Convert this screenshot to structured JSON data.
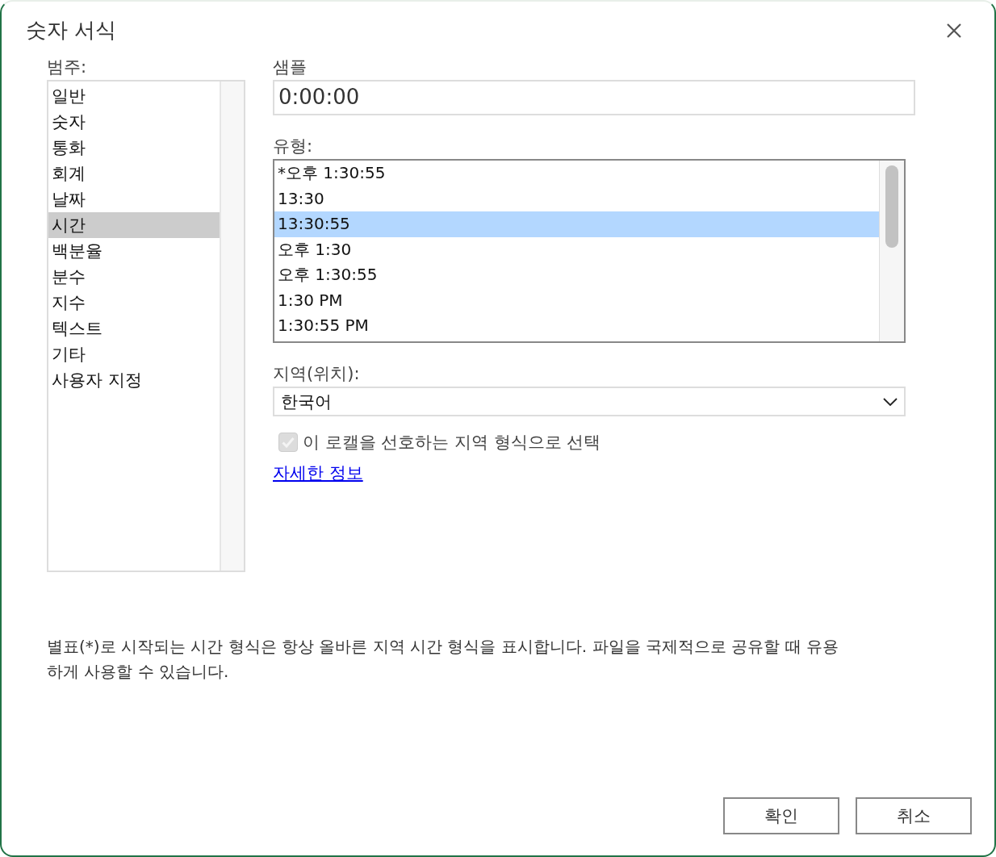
{
  "dialog": {
    "title": "숫자 서식"
  },
  "category": {
    "label": "범주:",
    "items": [
      {
        "label": "일반",
        "selected": false
      },
      {
        "label": "숫자",
        "selected": false
      },
      {
        "label": "통화",
        "selected": false
      },
      {
        "label": "회계",
        "selected": false
      },
      {
        "label": "날짜",
        "selected": false
      },
      {
        "label": "시간",
        "selected": true
      },
      {
        "label": "백분율",
        "selected": false
      },
      {
        "label": "분수",
        "selected": false
      },
      {
        "label": "지수",
        "selected": false
      },
      {
        "label": "텍스트",
        "selected": false
      },
      {
        "label": "기타",
        "selected": false
      },
      {
        "label": "사용자 지정",
        "selected": false
      }
    ]
  },
  "sample": {
    "label": "샘플",
    "value": "0:00:00"
  },
  "type": {
    "label": "유형:",
    "items": [
      {
        "label": "*오후 1:30:55",
        "selected": false
      },
      {
        "label": "13:30",
        "selected": false
      },
      {
        "label": "13:30:55",
        "selected": true
      },
      {
        "label": "오후 1:30",
        "selected": false
      },
      {
        "label": "오후 1:30:55",
        "selected": false
      },
      {
        "label": "1:30 PM",
        "selected": false
      },
      {
        "label": "1:30:55 PM",
        "selected": false
      }
    ]
  },
  "locale": {
    "label": "지역(위치):",
    "value": "한국어"
  },
  "preferred_locale": {
    "label": "이 로캘을 선호하는 지역 형식으로 선택",
    "checked": true,
    "disabled": true
  },
  "link": "자세한 정보",
  "description": "별표(*)로 시작되는 시간 형식은 항상 올바른 지역 시간 형식을 표시합니다. 파일을 국제적으로 공유할 때 유용하게 사용할 수 있습니다.",
  "buttons": [
    "확인",
    "취소"
  ]
}
